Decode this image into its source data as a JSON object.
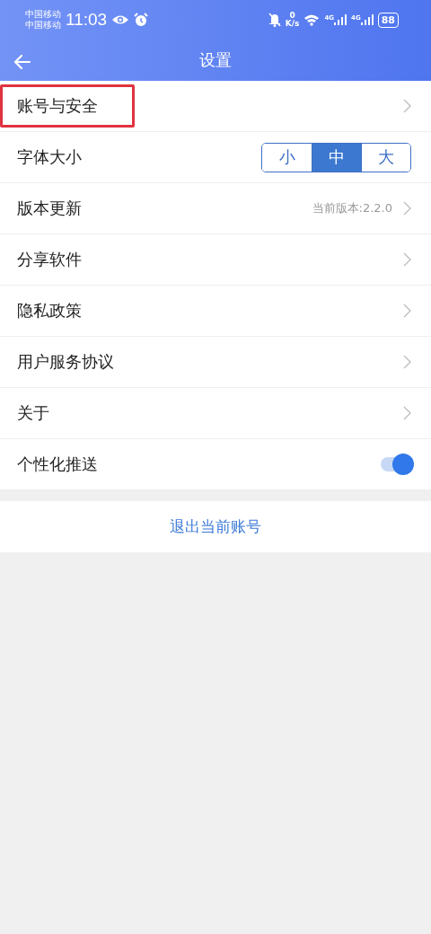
{
  "status_bar": {
    "carriers": [
      "中国移动",
      "中国移动"
    ],
    "time": "11:03",
    "speed_value": "0",
    "speed_unit": "K/s",
    "network_labels": [
      "4G",
      "4G"
    ],
    "battery": "88"
  },
  "header": {
    "title": "设置"
  },
  "settings": [
    {
      "kind": "link",
      "label": "账号与安全",
      "highlighted": true
    },
    {
      "kind": "segmented",
      "label": "字体大小",
      "options": [
        {
          "label": "小",
          "selected": false
        },
        {
          "label": "中",
          "selected": true
        },
        {
          "label": "大",
          "selected": false
        }
      ]
    },
    {
      "kind": "link",
      "label": "版本更新",
      "value": "当前版本:2.2.0"
    },
    {
      "kind": "link",
      "label": "分享软件"
    },
    {
      "kind": "link",
      "label": "隐私政策"
    },
    {
      "kind": "link",
      "label": "用户服务协议"
    },
    {
      "kind": "link",
      "label": "关于"
    },
    {
      "kind": "toggle",
      "label": "个性化推送",
      "on": true
    }
  ],
  "logout_button": "退出当前账号"
}
